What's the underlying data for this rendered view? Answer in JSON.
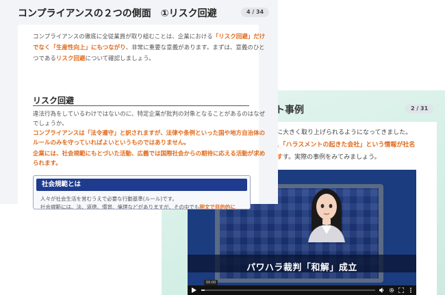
{
  "front": {
    "title_prefix": "コンプライアンスの２つの側面　",
    "title_circle": "①",
    "title_suffix": "リスク回避",
    "page": "4 / 34",
    "intro": {
      "l1_a": "コンプライアンスの徹底に全従業員が取り組むことは、企業における",
      "l1_b": "「リスク回避」だけ",
      "l2_a": "でなく「生産性向上」にもつながり",
      "l2_b": "、非常に重要な意義があります。まずは、意義のひと",
      "l3_a": "つである",
      "l3_b": "リスク回避",
      "l3_c": "について確認しましょう。"
    },
    "heading": "リスク回避",
    "body": {
      "l1": "違法行為をしているわけではないのに、特定企業が批判の対象となることがあるのはなぜ",
      "l2": "でしょうか。",
      "l3": "コンプライアンスは「法令遵守」と訳されますが、法律や条例といった国や地方自治体の",
      "l4": "ルールのみを守っていればよいというものではありません。",
      "l5": "企業には、社会規範にもとづいた活動、広義では国際社会からの期待に応える活動が求め",
      "l6": "られます。"
    },
    "box": {
      "title": "社会規範とは",
      "l1": "人々が社会生活を営むうえで必要な行動基準(ルール)です。",
      "l2": "社会規範には、法、道徳、慣習、倫理などがありますが、その中でも",
      "l2_hl": "明文で目的的に"
    }
  },
  "back": {
    "title": "ト事例",
    "page": "2 / 31",
    "l1": "に大きく取り上げられるようになってきました。",
    "l2_a": "、「ハラスメントの起きた会社」という情報が社名",
    "l3": "す。実際の事例をみてみましょう。",
    "video": {
      "caption": "パワハラ裁判「和解」成立",
      "time": "00:00",
      "progress": 0.02
    }
  },
  "colors": {
    "accent_orange": "#e06a1b",
    "navy": "#1f3b8e"
  }
}
